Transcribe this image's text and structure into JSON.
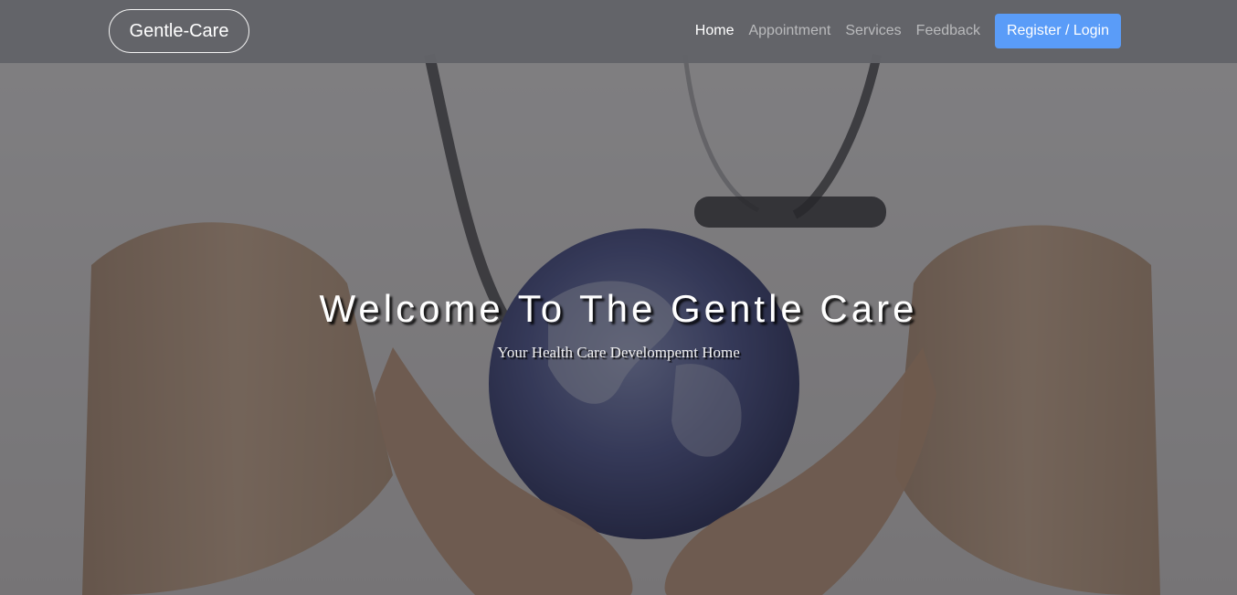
{
  "navbar": {
    "brand": "Gentle-Care",
    "links": [
      {
        "label": "Home",
        "active": true
      },
      {
        "label": "Appointment",
        "active": false
      },
      {
        "label": "Services",
        "active": false
      },
      {
        "label": "Feedback",
        "active": false
      }
    ],
    "cta_label": "Register / Login"
  },
  "hero": {
    "title": "Welcome To The Gentle Care",
    "subtitle": "Your Health Care Develompemt Home"
  },
  "colors": {
    "navbar_bg": "#626368",
    "cta_bg": "#5a9cf8",
    "link_active": "#ffffff",
    "link_inactive": "#b0b1b4"
  }
}
